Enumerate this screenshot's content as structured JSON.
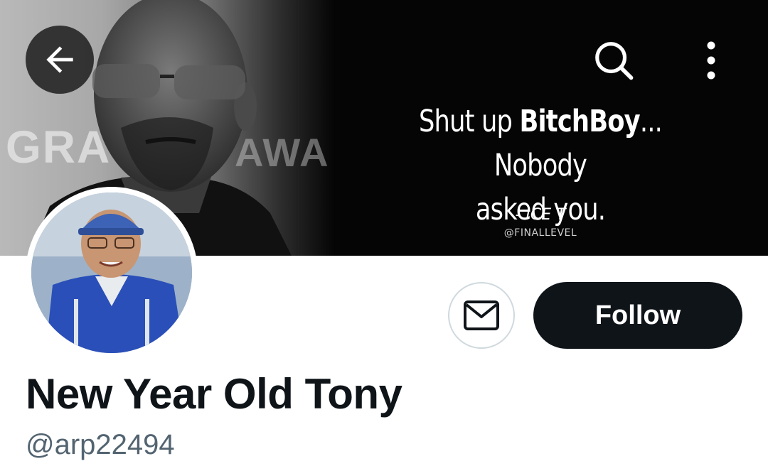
{
  "header": {
    "banner": {
      "wall_text_left": "GRA",
      "wall_text_right": "AWA",
      "quote_prefix": "Shut up ",
      "quote_bold": "BitchBoy",
      "quote_suffix": "... Nobody",
      "quote_line2": "asked you.",
      "attribution": "- ICE T",
      "credit": "@FINALLEVEL"
    },
    "icons": {
      "back": "back-arrow-icon",
      "search": "search-icon",
      "more": "more-vertical-icon"
    }
  },
  "profile": {
    "display_name": "New Year Old Tony",
    "username": "@arp22494",
    "follow_label": "Follow",
    "message_icon": "envelope-icon"
  },
  "colors": {
    "follow_bg": "#0f1419",
    "name_text": "#0f1419",
    "username_text": "#536471",
    "button_border": "#cfd9de"
  }
}
